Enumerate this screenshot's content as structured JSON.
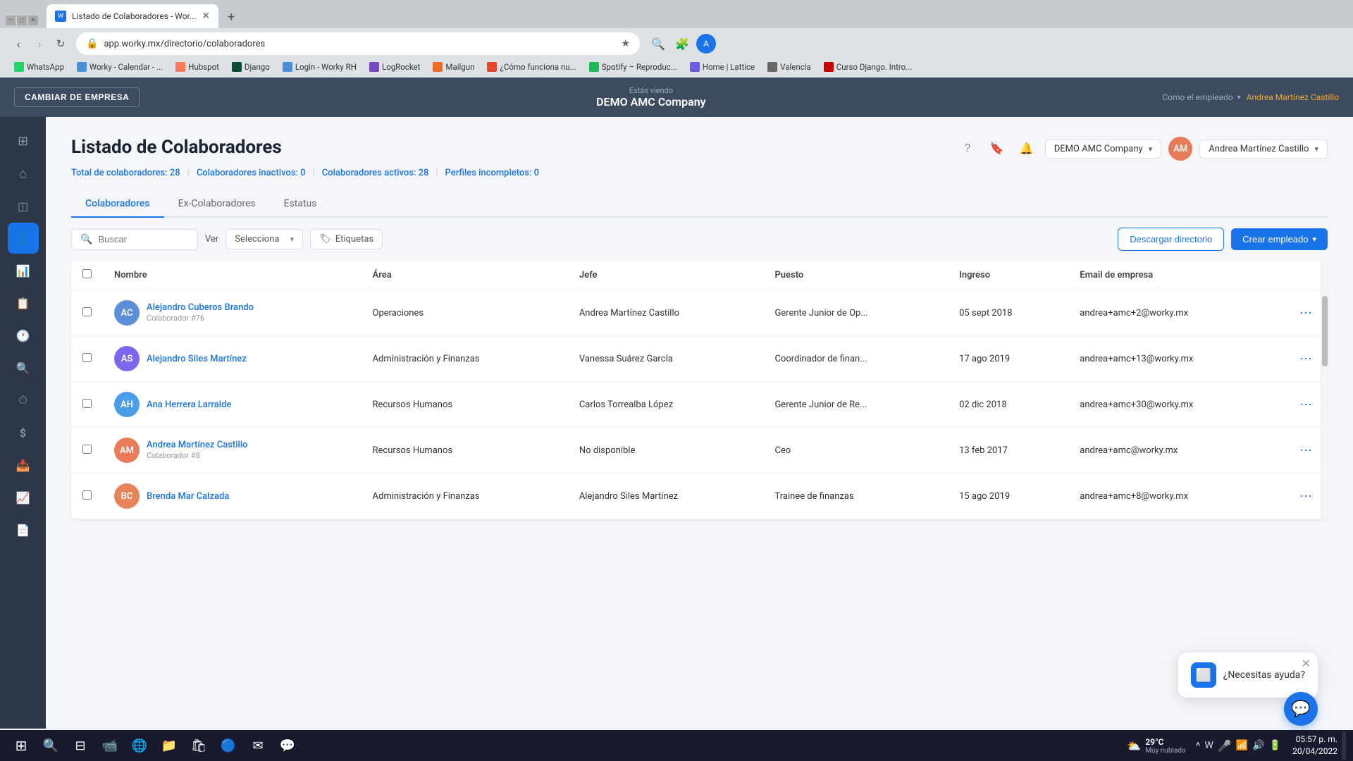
{
  "browser": {
    "tab": {
      "title": "Listado de Colaboradores - Wor...",
      "url": "app.worky.mx/directorio/colaboradores"
    },
    "bookmarks": [
      {
        "label": "WhatsApp",
        "color": "#25d366"
      },
      {
        "label": "Worky - Calendar - ...",
        "color": "#4a90d9"
      },
      {
        "label": "Hubspot",
        "color": "#ff7a59"
      },
      {
        "label": "Django",
        "color": "#0c4b33"
      },
      {
        "label": "Login - Worky RH",
        "color": "#4a90d9"
      },
      {
        "label": "LogRocket",
        "color": "#764abc"
      },
      {
        "label": "Mailgun",
        "color": "#f06b26"
      },
      {
        "label": "¿Cómo funciona nu...",
        "color": "#e8462a"
      },
      {
        "label": "Spotify – Reproduc...",
        "color": "#1db954"
      },
      {
        "label": "Home | Lattice",
        "color": "#6c5ce7"
      },
      {
        "label": "Valencia",
        "color": "#333"
      },
      {
        "label": "Curso Django. Intro...",
        "color": "#cc0000"
      }
    ]
  },
  "topbar": {
    "viewing_label": "Estás viendo",
    "company": "DEMO AMC Company",
    "role_label": "Como el empleado",
    "user_name": "Andrea Martínez Castillo",
    "cambiar_label": "CAMBIAR DE EMPRESA"
  },
  "page": {
    "title": "Listado de Colaboradores",
    "stats": {
      "total_label": "Total de colaboradores: 28",
      "inactive_label": "Colaboradores inactivos: 0",
      "active_label": "Colaboradores activos: 28",
      "incomplete_label": "Perfiles incompletos: 0"
    },
    "tabs": [
      {
        "label": "Colaboradores",
        "active": true
      },
      {
        "label": "Ex-Colaboradores",
        "active": false
      },
      {
        "label": "Estatus",
        "active": false
      }
    ],
    "search_placeholder": "Buscar",
    "ver_label": "Ver",
    "select_placeholder": "Selecciona",
    "etiquetas_label": "Etiquetas",
    "btn_descargar": "Descargar directorio",
    "btn_crear": "Crear empleado",
    "table": {
      "columns": [
        {
          "label": "Nombre",
          "sortable": true
        },
        {
          "label": "Área",
          "sortable": true
        },
        {
          "label": "Jefe",
          "sortable": true
        },
        {
          "label": "Puesto",
          "sortable": true
        },
        {
          "label": "Ingreso",
          "sortable": true
        },
        {
          "label": "Email de empresa",
          "sortable": true
        }
      ],
      "rows": [
        {
          "id": 1,
          "name": "Alejandro Cuberos Brando",
          "employee_id": "Colaborador #76",
          "area": "Operaciones",
          "jefe": "Andrea Martínez Castillo",
          "puesto": "Gerente Junior de Op...",
          "ingreso": "05 sept 2018",
          "email": "andrea+amc+2@worky.mx",
          "avatar_color": "#5b8dd9",
          "initials": "AC"
        },
        {
          "id": 2,
          "name": "Alejandro Siles Martínez",
          "employee_id": "",
          "area": "Administración y Finanzas",
          "jefe": "Vanessa Suárez García",
          "puesto": "Coordinador de finan...",
          "ingreso": "17 ago 2019",
          "email": "andrea+amc+13@worky.mx",
          "avatar_color": "#7b68ee",
          "initials": "AS"
        },
        {
          "id": 3,
          "name": "Ana Herrera Larralde",
          "employee_id": "",
          "area": "Recursos Humanos",
          "jefe": "Carlos Torrealba López",
          "puesto": "Gerente Junior de Re...",
          "ingreso": "02 dic 2018",
          "email": "andrea+amc+30@worky.mx",
          "avatar_color": "#4a9de8",
          "initials": "AH"
        },
        {
          "id": 4,
          "name": "Andrea Martínez Castillo",
          "employee_id": "Colaborador #8",
          "area": "Recursos Humanos",
          "jefe": "No disponible",
          "puesto": "Ceo",
          "ingreso": "13 feb 2017",
          "email": "andrea+amc@worky.mx",
          "avatar_color": "#e87b5a",
          "initials": "AM"
        },
        {
          "id": 5,
          "name": "Brenda Mar Calzada",
          "employee_id": "",
          "area": "Administración y Finanzas",
          "jefe": "Alejandro Siles Martínez",
          "puesto": "Trainee de finanzas",
          "ingreso": "15 ago 2019",
          "email": "andrea+amc+8@worky.mx",
          "avatar_color": "#e8845a",
          "initials": "BC"
        }
      ]
    }
  },
  "chat": {
    "widget_text": "¿Necesitas ayuda?"
  },
  "sidebar": {
    "icons": [
      {
        "name": "grid-icon",
        "symbol": "⊞",
        "active": false
      },
      {
        "name": "home-icon",
        "symbol": "⌂",
        "active": false
      },
      {
        "name": "calendar-icon",
        "symbol": "📅",
        "active": false
      },
      {
        "name": "people-icon",
        "symbol": "👤",
        "active": true
      },
      {
        "name": "chart-icon",
        "symbol": "📊",
        "active": false
      },
      {
        "name": "report-icon",
        "symbol": "📋",
        "active": false
      },
      {
        "name": "clock-icon",
        "symbol": "🕐",
        "active": false
      },
      {
        "name": "search2-icon",
        "symbol": "🔍",
        "active": false
      },
      {
        "name": "timer-icon",
        "symbol": "⏱",
        "active": false
      },
      {
        "name": "dollar-icon",
        "symbol": "$",
        "active": false
      },
      {
        "name": "inbox-icon",
        "symbol": "📥",
        "active": false
      },
      {
        "name": "bar-chart-icon",
        "symbol": "📈",
        "active": false
      },
      {
        "name": "doc-icon",
        "symbol": "📄",
        "active": false
      }
    ]
  },
  "taskbar": {
    "time": "05:57 p. m.",
    "date": "20/04/2022",
    "weather": {
      "temp": "29°C",
      "condition": "Muy nublado"
    }
  }
}
